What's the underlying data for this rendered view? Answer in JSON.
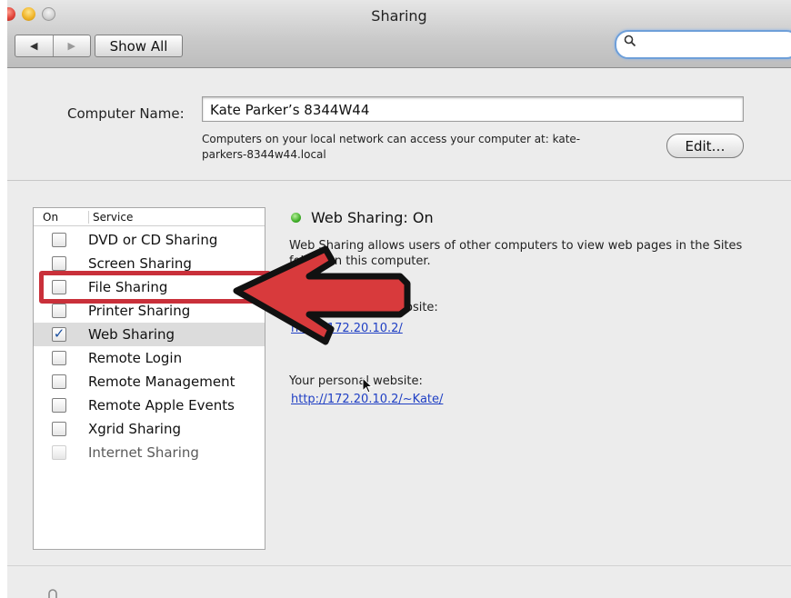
{
  "window": {
    "title": "Sharing"
  },
  "toolbar": {
    "back_icon": "◀",
    "forward_icon": "▶",
    "show_all_label": "Show All"
  },
  "search": {
    "icon": "magnifier-icon",
    "value": "",
    "placeholder": ""
  },
  "computer_name": {
    "label": "Computer Name:",
    "value": "Kate Parker’s 8344W44",
    "description_line1": "Computers on your local network can access your computer at: kate-",
    "description_line2": "parkers-8344w44.local",
    "edit_label": "Edit…"
  },
  "services": {
    "header_on": "On",
    "header_service": "Service",
    "items": [
      {
        "label": "DVD or CD Sharing",
        "checked": false,
        "mark": ""
      },
      {
        "label": "Screen Sharing",
        "checked": false,
        "mark": ""
      },
      {
        "label": "File Sharing",
        "checked": false,
        "mark": ""
      },
      {
        "label": "Printer Sharing",
        "checked": false,
        "mark": ""
      },
      {
        "label": "Web Sharing",
        "checked": true,
        "mark": "✓",
        "selected": true
      },
      {
        "label": "Remote Login",
        "checked": false,
        "mark": ""
      },
      {
        "label": "Remote Management",
        "checked": false,
        "mark": ""
      },
      {
        "label": "Remote Apple Events",
        "checked": false,
        "mark": ""
      },
      {
        "label": "Xgrid Sharing",
        "checked": false,
        "mark": ""
      },
      {
        "label": "Internet Sharing",
        "checked": false,
        "mark": "",
        "disabled": true
      }
    ]
  },
  "detail": {
    "status_title": "Web Sharing: On",
    "status_color": "#3fae27",
    "description": "Web Sharing allows users of other computers to view web pages in the Sites folder on this computer.",
    "computer_website_label": "Your computer's website:",
    "computer_website_url": "http://172.20.10.2/",
    "personal_website_label": "Your personal website:",
    "personal_website_url": "http://172.20.10.2/~Kate/"
  },
  "annotation": {
    "highlight_color": "#c9303a"
  }
}
